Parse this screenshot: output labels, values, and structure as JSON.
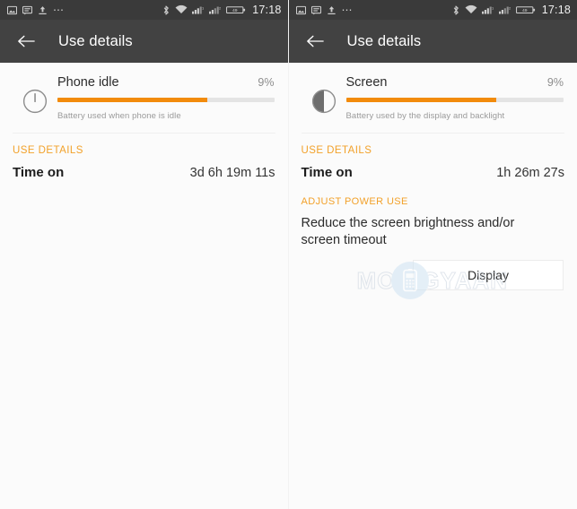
{
  "status_bar": {
    "icons": [
      "image-icon",
      "message-icon",
      "upload-icon",
      "more-dots-icon"
    ],
    "right_icons": [
      "bluetooth-icon",
      "wifi-icon",
      "signal-sim1-icon",
      "signal-sim2-icon",
      "battery-icon"
    ],
    "battery_level": "49",
    "time": "17:18",
    "more_dots": "⋯"
  },
  "toolbar": {
    "back_icon": "back-arrow-icon",
    "title": "Use details"
  },
  "panels": [
    {
      "id": "phone-idle",
      "header": {
        "icon": "power-icon",
        "title": "Phone idle",
        "percent": "9%",
        "bar_fill_percent": 69,
        "subtitle": "Battery used when phone is idle"
      },
      "use_details": {
        "label": "USE DETAILS",
        "rows": [
          {
            "key": "Time on",
            "value": "3d 6h 19m 11s"
          }
        ]
      },
      "adjust_power_use": null,
      "watermark": null
    },
    {
      "id": "screen",
      "header": {
        "icon": "brightness-icon",
        "title": "Screen",
        "percent": "9%",
        "bar_fill_percent": 69,
        "subtitle": "Battery used by the display and backlight"
      },
      "use_details": {
        "label": "USE DETAILS",
        "rows": [
          {
            "key": "Time on",
            "value": "1h 26m 27s"
          }
        ]
      },
      "adjust_power_use": {
        "label": "ADJUST POWER USE",
        "text": "Reduce the screen brightness and/or screen timeout",
        "button_label": "Display"
      },
      "watermark": {
        "text": "MOBIGYAAN",
        "logo": "mobile-phone-logo-icon"
      }
    }
  ],
  "colors": {
    "accent": "#f2a12a",
    "bar_fill": "#f28b0c",
    "toolbar_bg": "#424242",
    "statusbar_bg": "#3a3a3a",
    "page_bg": "#fbfbfb"
  }
}
